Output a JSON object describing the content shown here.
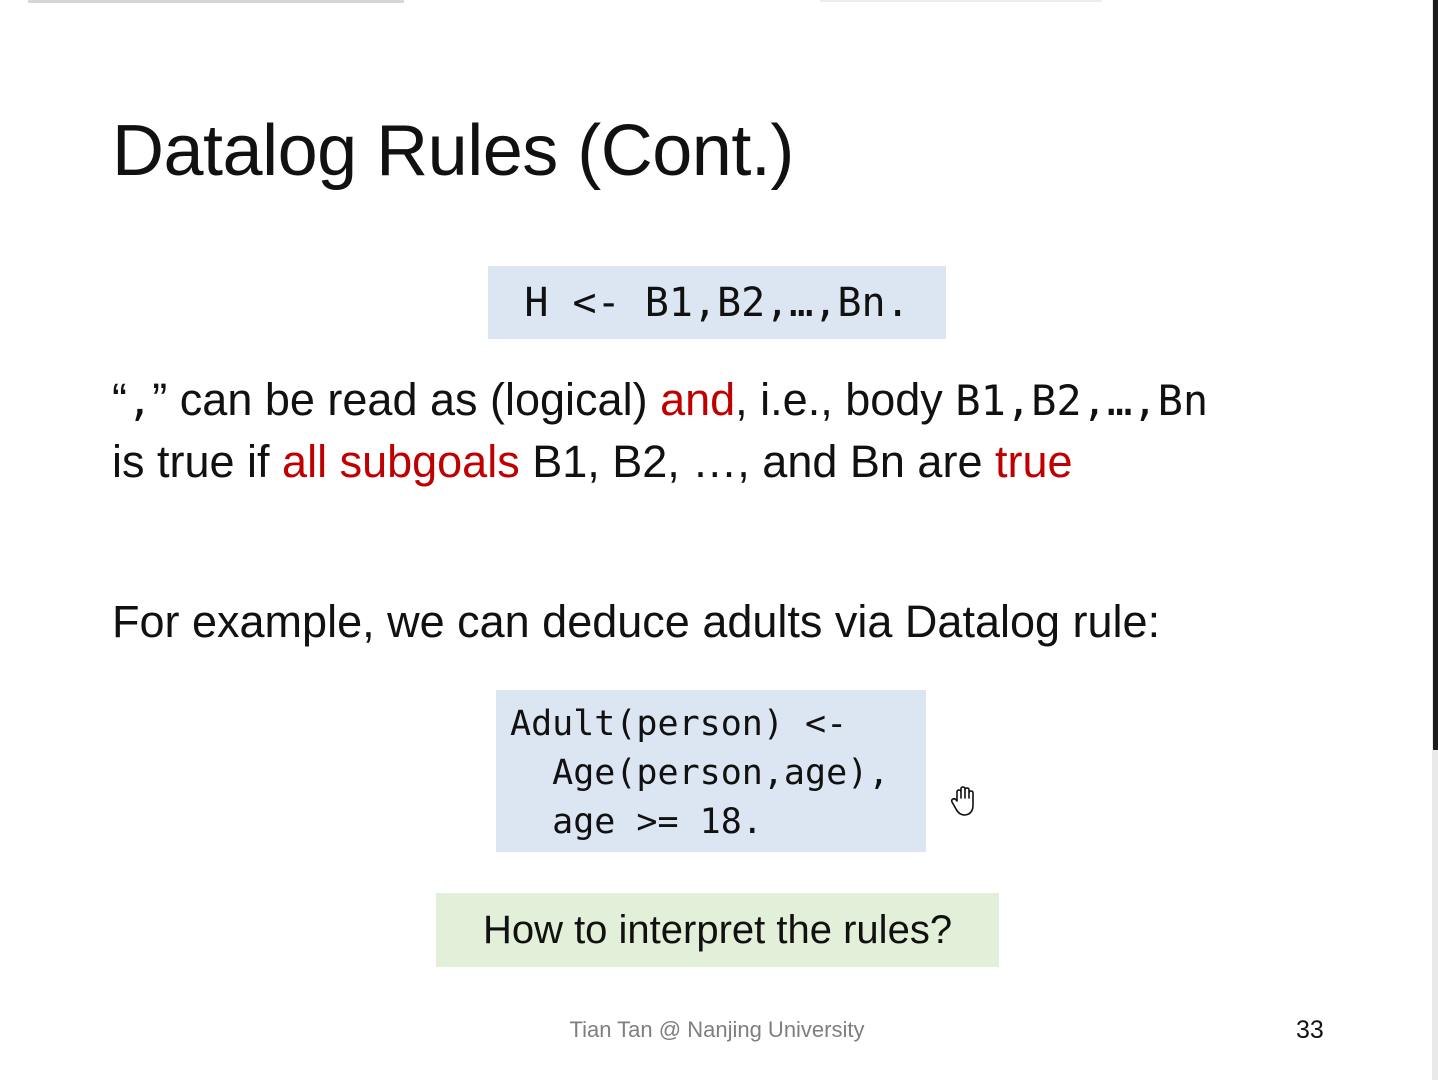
{
  "slide": {
    "title": "Datalog Rules (Cont.)",
    "rule_form": "H <- B1,B2,…,Bn.",
    "explanation": {
      "q_open": "“",
      "comma_mono": ",",
      "q_close": "”",
      "t1": " can be read as (logical) ",
      "and": "and",
      "t2": ", i.e., body ",
      "body_mono": "B1,B2,…,Bn",
      "t3": "is true if ",
      "all_subgoals": "all subgoals",
      "t4": " B1, B2, …, and Bn are ",
      "true": "true"
    },
    "example_intro": "For example, we can deduce adults via Datalog rule:",
    "example_code": [
      "Adult(person) <-",
      "  Age(person,age),",
      "  age >= 18."
    ],
    "question": "How to interpret the rules?",
    "footer": "Tian Tan @ Nanjing University",
    "page_number": "33"
  },
  "colors": {
    "code_bg": "#dce6f2",
    "question_bg": "#e2efd9",
    "highlight": "#c00000",
    "footer_text": "#7f7f7f"
  },
  "icons": {
    "cursor": "hand-grab-icon"
  }
}
